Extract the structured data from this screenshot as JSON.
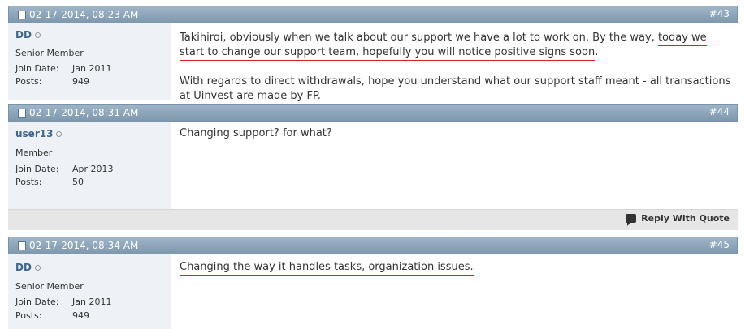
{
  "posts": [
    {
      "date": "02-17-2014, 08:23 AM",
      "number": "#43",
      "user": {
        "name": "DD",
        "title": "Senior Member",
        "join_label": "Join Date:",
        "join_date": "Jan 2011",
        "posts_label": "Posts:",
        "posts": "949"
      },
      "message": {
        "p1_a": "Takihiroi, obviously when we talk about our support we have a lot to work on. By the way, ",
        "p1_b": "today we start to change our support team, hopefully you will notice positive signs soon",
        "p1_c": ".",
        "p2": "With regards to direct withdrawals, hope you understand what our support staff meant - all transactions at Uinvest are made by FP."
      }
    },
    {
      "date": "02-17-2014, 08:31 AM",
      "number": "#44",
      "user": {
        "name": "user13",
        "title": "Member",
        "join_label": "Join Date:",
        "join_date": "Apr 2013",
        "posts_label": "Posts:",
        "posts": "50"
      },
      "message": {
        "p1": "Changing support? for what?"
      },
      "reply_label": "Reply With Quote"
    },
    {
      "date": "02-17-2014, 08:34 AM",
      "number": "#45",
      "user": {
        "name": "DD",
        "title": "Senior Member",
        "join_label": "Join Date:",
        "join_date": "Jan 2011",
        "posts_label": "Posts:",
        "posts": "949"
      },
      "message": {
        "p1": "Changing the way it handles tasks, organization issues. "
      }
    }
  ],
  "icons": {
    "post_icon": "document-icon",
    "status_icon": "offline-status-icon",
    "reply_icon": "quote-bubble-icon"
  }
}
